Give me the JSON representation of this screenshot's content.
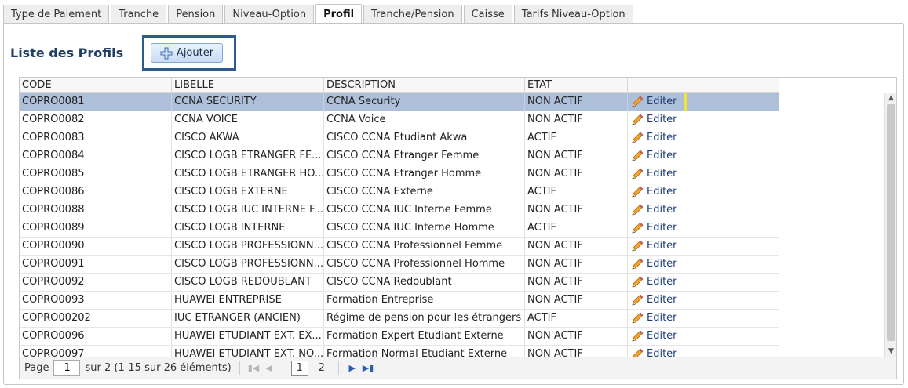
{
  "tabs": [
    {
      "label": "Type de Paiement",
      "active": false
    },
    {
      "label": "Tranche",
      "active": false
    },
    {
      "label": "Pension",
      "active": false
    },
    {
      "label": "Niveau-Option",
      "active": false
    },
    {
      "label": "Profil",
      "active": true
    },
    {
      "label": "Tranche/Pension",
      "active": false
    },
    {
      "label": "Caisse",
      "active": false
    },
    {
      "label": "Tarifs Niveau-Option",
      "active": false
    }
  ],
  "page_title": "Liste des Profils",
  "add_button": {
    "label": "Ajouter",
    "icon": "plus-icon"
  },
  "columns": [
    "CODE",
    "LIBELLE",
    "DESCRIPTION",
    "ETAT",
    ""
  ],
  "edit_label": "Editer",
  "edit_icon": "pencil-icon",
  "rows": [
    {
      "code": "COPRO0081",
      "libelle": "CCNA SECURITY",
      "description": "CCNA Security",
      "etat": "NON ACTIF",
      "selected": true
    },
    {
      "code": "COPRO0082",
      "libelle": "CCNA VOICE",
      "description": "CCNA Voice",
      "etat": "NON ACTIF"
    },
    {
      "code": "COPRO0083",
      "libelle": "CISCO AKWA",
      "description": "CISCO CCNA Etudiant Akwa",
      "etat": "ACTIF"
    },
    {
      "code": "COPRO0084",
      "libelle": "CISCO LOGB ETRANGER FE...",
      "description": "CISCO CCNA Etranger Femme",
      "etat": "NON ACTIF"
    },
    {
      "code": "COPRO0085",
      "libelle": "CISCO LOGB ETRANGER HO...",
      "description": "CISCO CCNA Etranger Homme",
      "etat": "NON ACTIF"
    },
    {
      "code": "COPRO0086",
      "libelle": "CISCO LOGB EXTERNE",
      "description": "CISCO CCNA Externe",
      "etat": "ACTIF"
    },
    {
      "code": "COPRO0088",
      "libelle": "CISCO LOGB IUC INTERNE F...",
      "description": "CISCO CCNA IUC Interne Femme",
      "etat": "NON ACTIF"
    },
    {
      "code": "COPRO0089",
      "libelle": "CISCO LOGB INTERNE",
      "description": "CISCO CCNA IUC Interne Homme",
      "etat": "ACTIF"
    },
    {
      "code": "COPRO0090",
      "libelle": "CISCO LOGB PROFESSIONN...",
      "description": "CISCO CCNA Professionnel Femme",
      "etat": "NON ACTIF"
    },
    {
      "code": "COPRO0091",
      "libelle": "CISCO LOGB PROFESSIONN...",
      "description": "CISCO CCNA Professionnel Homme",
      "etat": "NON ACTIF"
    },
    {
      "code": "COPRO0092",
      "libelle": "CISCO LOGB REDOUBLANT",
      "description": "CISCO CCNA Redoublant",
      "etat": "NON ACTIF"
    },
    {
      "code": "COPRO0093",
      "libelle": "HUAWEI ENTREPRISE",
      "description": "Formation Entreprise",
      "etat": "NON ACTIF"
    },
    {
      "code": "COPRO00202",
      "libelle": "IUC ETRANGER (ANCIEN)",
      "description": "Régime de pension pour les étrangers ...",
      "etat": "ACTIF"
    },
    {
      "code": "COPRO0096",
      "libelle": "HUAWEI ETUDIANT EXT. EX...",
      "description": "Formation Expert Etudiant Externe",
      "etat": "NON ACTIF"
    },
    {
      "code": "COPRO0097",
      "libelle": "HUAWEI ETUDIANT EXT. NO...",
      "description": "Formation Normal Etudiant Externe",
      "etat": "NON ACTIF"
    }
  ],
  "pager": {
    "page_label": "Page",
    "page_value": "1",
    "of_label": "sur 2 (1-15 sur 26 éléments)",
    "pages": [
      "1",
      "2"
    ]
  },
  "colors": {
    "accent": "#2e5a90",
    "selected_row": "#aebfd9",
    "edit_highlight": "#f2e635"
  }
}
